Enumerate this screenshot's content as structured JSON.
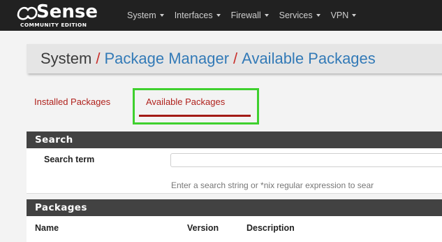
{
  "brand": {
    "name": "Sense",
    "edition": "COMMUNITY EDITION"
  },
  "nav": {
    "items": [
      {
        "label": "System"
      },
      {
        "label": "Interfaces"
      },
      {
        "label": "Firewall"
      },
      {
        "label": "Services"
      },
      {
        "label": "VPN"
      }
    ]
  },
  "breadcrumb": {
    "root": "System",
    "separator": "/",
    "item1": "Package Manager",
    "item2": "Available Packages"
  },
  "tabs": {
    "installed": "Installed Packages",
    "available": "Available Packages",
    "active": "Available Packages"
  },
  "search": {
    "heading": "Search",
    "term_label": "Search term",
    "term_value": "",
    "help": "Enter a search string or *nix regular expression to sear"
  },
  "packages": {
    "heading": "Packages",
    "columns": [
      "Name",
      "Version",
      "Description"
    ]
  },
  "colors": {
    "navbar": "#212121",
    "link": "#337ab7",
    "accent_red": "#b0221d",
    "highlight_green": "#3fd02e",
    "panel_heading": "#424242"
  }
}
